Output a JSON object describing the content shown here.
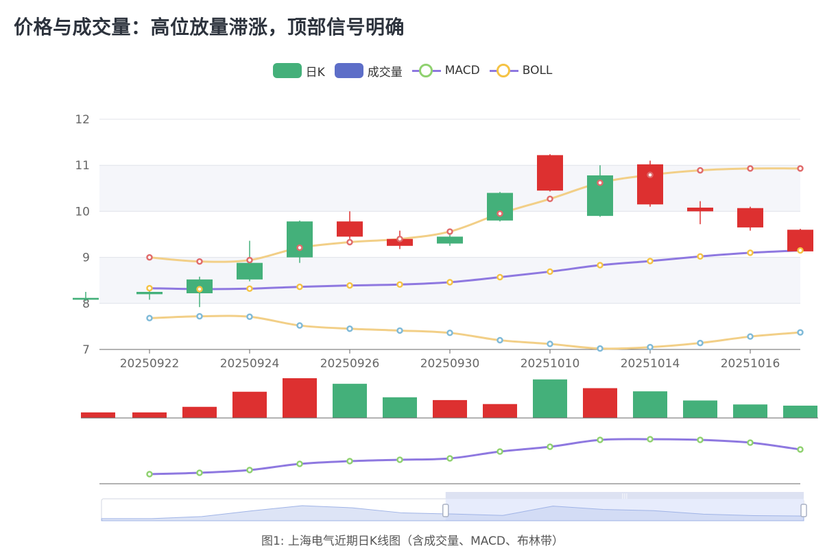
{
  "title": "价格与成交量：高位放量滞涨，顶部信号明确",
  "legend": [
    {
      "label": "日K",
      "kind": "box",
      "color": "#44b07a"
    },
    {
      "label": "成交量",
      "kind": "box",
      "color": "#5d6ec8"
    },
    {
      "label": "MACD",
      "kind": "line",
      "color": "#8fd16f"
    },
    {
      "label": "BOLL",
      "kind": "line",
      "color": "#f5c344"
    }
  ],
  "caption": "图1: 上海电气近期日K线图（含成交量、MACD、布林带）",
  "chart_data": {
    "type": "candlestick",
    "y_axis": {
      "min": 7,
      "max": 12,
      "ticks": [
        7,
        8,
        9,
        10,
        11,
        12
      ]
    },
    "x_tick_labels": [
      "20250922",
      "20250924",
      "20250926",
      "20250930",
      "20251010",
      "20251014",
      "20251016"
    ],
    "x_tick_indices": [
      1,
      3,
      5,
      7,
      9,
      11,
      13
    ],
    "colors": {
      "up": "#dd3030",
      "down": "#44b07a"
    },
    "candles": [
      {
        "o": 8.08,
        "c": 8.12,
        "h": 8.25,
        "l": 8.05,
        "dir": "down"
      },
      {
        "o": 8.2,
        "c": 8.25,
        "h": 8.28,
        "l": 8.08,
        "dir": "down"
      },
      {
        "o": 8.22,
        "c": 8.52,
        "h": 8.58,
        "l": 7.92,
        "dir": "down"
      },
      {
        "o": 8.52,
        "c": 8.88,
        "h": 9.36,
        "l": 8.48,
        "dir": "down"
      },
      {
        "o": 9.0,
        "c": 9.78,
        "h": 9.8,
        "l": 8.88,
        "dir": "down"
      },
      {
        "o": 9.45,
        "c": 9.78,
        "h": 10.0,
        "l": 9.4,
        "dir": "up"
      },
      {
        "o": 9.25,
        "c": 9.4,
        "h": 9.58,
        "l": 9.18,
        "dir": "up"
      },
      {
        "o": 9.3,
        "c": 9.45,
        "h": 9.5,
        "l": 9.25,
        "dir": "down"
      },
      {
        "o": 9.8,
        "c": 10.4,
        "h": 10.42,
        "l": 9.78,
        "dir": "down"
      },
      {
        "o": 10.45,
        "c": 11.22,
        "h": 11.24,
        "l": 10.43,
        "dir": "up"
      },
      {
        "o": 9.9,
        "c": 10.78,
        "h": 11.0,
        "l": 9.88,
        "dir": "down"
      },
      {
        "o": 10.15,
        "c": 11.02,
        "h": 11.1,
        "l": 10.1,
        "dir": "up"
      },
      {
        "o": 10.0,
        "c": 10.08,
        "h": 10.22,
        "l": 9.72,
        "dir": "up"
      },
      {
        "o": 9.65,
        "c": 10.07,
        "h": 10.1,
        "l": 9.58,
        "dir": "up"
      },
      {
        "o": 9.13,
        "c": 9.6,
        "h": 9.62,
        "l": 9.1,
        "dir": "up"
      }
    ],
    "boll_upper": [
      null,
      9.0,
      8.91,
      8.94,
      9.21,
      9.33,
      9.4,
      9.56,
      9.95,
      10.27,
      10.62,
      10.79,
      10.89,
      10.93,
      10.93
    ],
    "boll_mid": [
      null,
      8.33,
      8.31,
      8.32,
      8.36,
      8.39,
      8.41,
      8.46,
      8.57,
      8.69,
      8.83,
      8.92,
      9.02,
      9.1,
      9.15
    ],
    "boll_lower": [
      null,
      7.68,
      7.72,
      7.71,
      7.52,
      7.45,
      7.41,
      7.36,
      7.2,
      7.12,
      7.02,
      7.05,
      7.14,
      7.28,
      7.37
    ],
    "volume": {
      "max": 100,
      "values": [
        14,
        14,
        28,
        66,
        100,
        86,
        52,
        45,
        35,
        97,
        75,
        67,
        44,
        34,
        31
      ],
      "dir": [
        "up",
        "up",
        "up",
        "up",
        "up",
        "down",
        "down",
        "up",
        "up",
        "down",
        "up",
        "down",
        "down",
        "down",
        "down"
      ]
    },
    "macd": {
      "min": 0,
      "max": 1,
      "values": [
        null,
        0.21,
        0.23,
        0.27,
        0.36,
        0.4,
        0.42,
        0.44,
        0.54,
        0.61,
        0.71,
        0.72,
        0.71,
        0.67,
        0.57
      ]
    },
    "navigator": {
      "range_start": 0.49,
      "range_end": 1.0
    }
  }
}
